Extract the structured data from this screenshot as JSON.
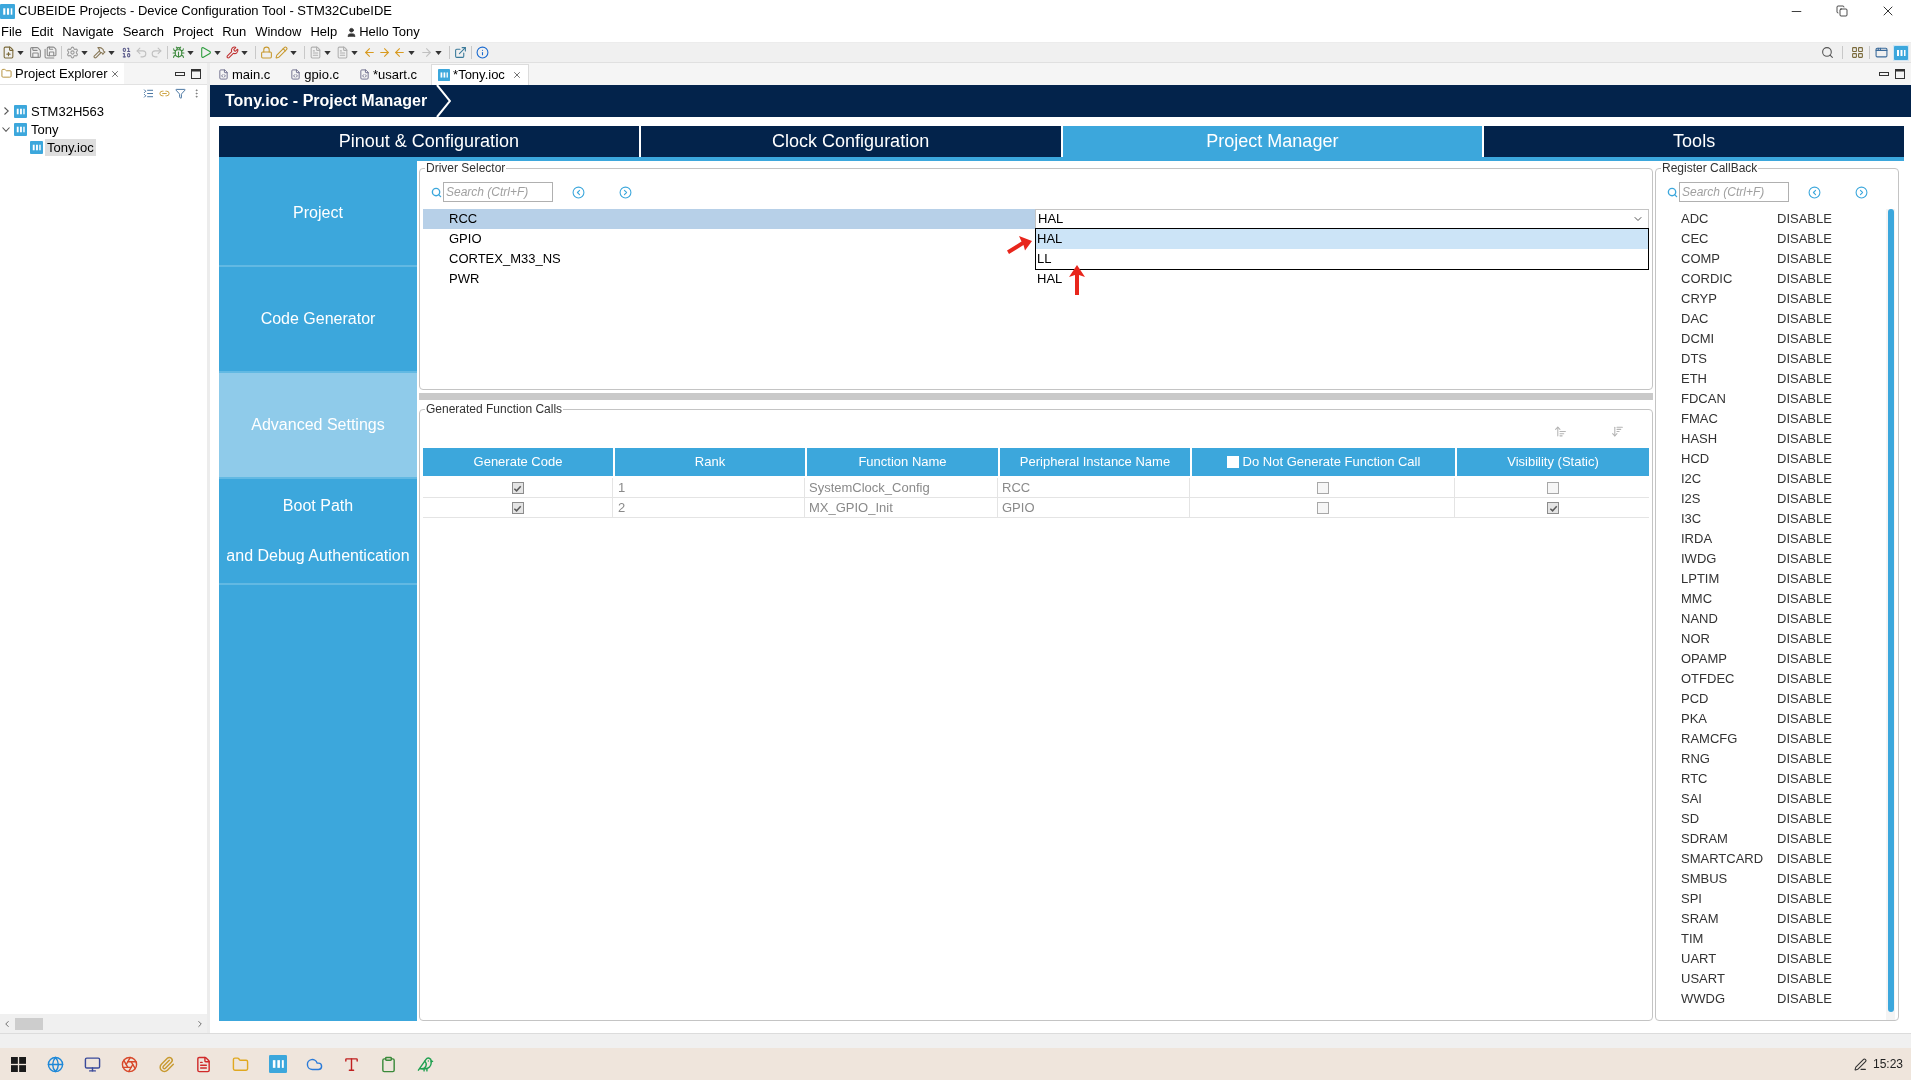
{
  "window": {
    "title": "CUBEIDE Projects - Device Configuration Tool - STM32CubeIDE"
  },
  "menu": {
    "items": [
      "File",
      "Edit",
      "Navigate",
      "Search",
      "Project",
      "Run",
      "Window",
      "Help"
    ],
    "user": "Hello Tony"
  },
  "project_explorer": {
    "title": "Project Explorer",
    "tree": [
      {
        "label": "STM32H563",
        "kind": "project",
        "expanded": false,
        "selected": false
      },
      {
        "label": "Tony",
        "kind": "project",
        "expanded": true,
        "selected": false,
        "children": [
          {
            "label": "Tony.ioc",
            "kind": "ioc",
            "selected": true
          }
        ]
      }
    ]
  },
  "editor_tabs": [
    {
      "label": "main.c",
      "kind": "c",
      "selected": false
    },
    {
      "label": "gpio.c",
      "kind": "c",
      "selected": false
    },
    {
      "label": "*usart.c",
      "kind": "c",
      "selected": false
    },
    {
      "label": "*Tony.ioc",
      "kind": "mx",
      "selected": true
    }
  ],
  "breadcrumb": "Tony.ioc - Project Manager",
  "main_tabs": [
    {
      "label": "Pinout & Configuration",
      "selected": false
    },
    {
      "label": "Clock Configuration",
      "selected": false
    },
    {
      "label": "Project Manager",
      "selected": true
    },
    {
      "label": "Tools",
      "selected": false
    }
  ],
  "side_nav": [
    {
      "lines": [
        "Project"
      ],
      "selected": false
    },
    {
      "lines": [
        "Code Generator"
      ],
      "selected": false
    },
    {
      "lines": [
        "Advanced Settings"
      ],
      "selected": true
    },
    {
      "lines": [
        "Boot Path",
        "and Debug Authentication"
      ],
      "selected": false
    }
  ],
  "driver_selector": {
    "title": "Driver Selector",
    "search": {
      "placeholder": "Search (Ctrl+F)"
    },
    "rows": [
      {
        "name": "RCC",
        "value": "HAL",
        "selected": true
      },
      {
        "name": "GPIO",
        "selected": false
      },
      {
        "name": "CORTEX_M33_NS",
        "selected": false
      },
      {
        "name": "PWR",
        "value": "HAL",
        "selected": false
      }
    ],
    "dropdown": {
      "options": [
        {
          "label": "HAL",
          "selected": true
        },
        {
          "label": "LL",
          "selected": false
        }
      ]
    }
  },
  "generated_function_calls": {
    "title": "Generated Function Calls",
    "columns": [
      "Generate Code",
      "Rank",
      "Function Name",
      "Peripheral Instance Name",
      "Do Not Generate Function Call",
      "Visibility (Static)"
    ],
    "select_all": {
      "checked": false
    },
    "rows": [
      {
        "generate_code": true,
        "rank": "1",
        "function_name": "SystemClock_Config",
        "peripheral_instance": "RCC",
        "do_not_generate": false,
        "visibility_static": false
      },
      {
        "generate_code": true,
        "rank": "2",
        "function_name": "MX_GPIO_Init",
        "peripheral_instance": "GPIO",
        "do_not_generate": false,
        "visibility_static": true
      }
    ]
  },
  "register_callback": {
    "title": "Register CallBack",
    "search": {
      "placeholder": "Search (Ctrl+F)"
    },
    "rows": [
      {
        "name": "ADC",
        "value": "DISABLE"
      },
      {
        "name": "CEC",
        "value": "DISABLE"
      },
      {
        "name": "COMP",
        "value": "DISABLE"
      },
      {
        "name": "CORDIC",
        "value": "DISABLE"
      },
      {
        "name": "CRYP",
        "value": "DISABLE"
      },
      {
        "name": "DAC",
        "value": "DISABLE"
      },
      {
        "name": "DCMI",
        "value": "DISABLE"
      },
      {
        "name": "DTS",
        "value": "DISABLE"
      },
      {
        "name": "ETH",
        "value": "DISABLE"
      },
      {
        "name": "FDCAN",
        "value": "DISABLE"
      },
      {
        "name": "FMAC",
        "value": "DISABLE"
      },
      {
        "name": "HASH",
        "value": "DISABLE"
      },
      {
        "name": "HCD",
        "value": "DISABLE"
      },
      {
        "name": "I2C",
        "value": "DISABLE"
      },
      {
        "name": "I2S",
        "value": "DISABLE"
      },
      {
        "name": "I3C",
        "value": "DISABLE"
      },
      {
        "name": "IRDA",
        "value": "DISABLE"
      },
      {
        "name": "IWDG",
        "value": "DISABLE"
      },
      {
        "name": "LPTIM",
        "value": "DISABLE"
      },
      {
        "name": "MMC",
        "value": "DISABLE"
      },
      {
        "name": "NAND",
        "value": "DISABLE"
      },
      {
        "name": "NOR",
        "value": "DISABLE"
      },
      {
        "name": "OPAMP",
        "value": "DISABLE"
      },
      {
        "name": "OTFDEC",
        "value": "DISABLE"
      },
      {
        "name": "PCD",
        "value": "DISABLE"
      },
      {
        "name": "PKA",
        "value": "DISABLE"
      },
      {
        "name": "RAMCFG",
        "value": "DISABLE"
      },
      {
        "name": "RNG",
        "value": "DISABLE"
      },
      {
        "name": "RTC",
        "value": "DISABLE"
      },
      {
        "name": "SAI",
        "value": "DISABLE"
      },
      {
        "name": "SD",
        "value": "DISABLE"
      },
      {
        "name": "SDRAM",
        "value": "DISABLE"
      },
      {
        "name": "SMARTCARD",
        "value": "DISABLE"
      },
      {
        "name": "SMBUS",
        "value": "DISABLE"
      },
      {
        "name": "SPI",
        "value": "DISABLE"
      },
      {
        "name": "SRAM",
        "value": "DISABLE"
      },
      {
        "name": "TIM",
        "value": "DISABLE"
      },
      {
        "name": "UART",
        "value": "DISABLE"
      },
      {
        "name": "USART",
        "value": "DISABLE"
      },
      {
        "name": "WWDG",
        "value": "DISABLE"
      }
    ]
  },
  "taskbar": {
    "clock": "15:23"
  }
}
